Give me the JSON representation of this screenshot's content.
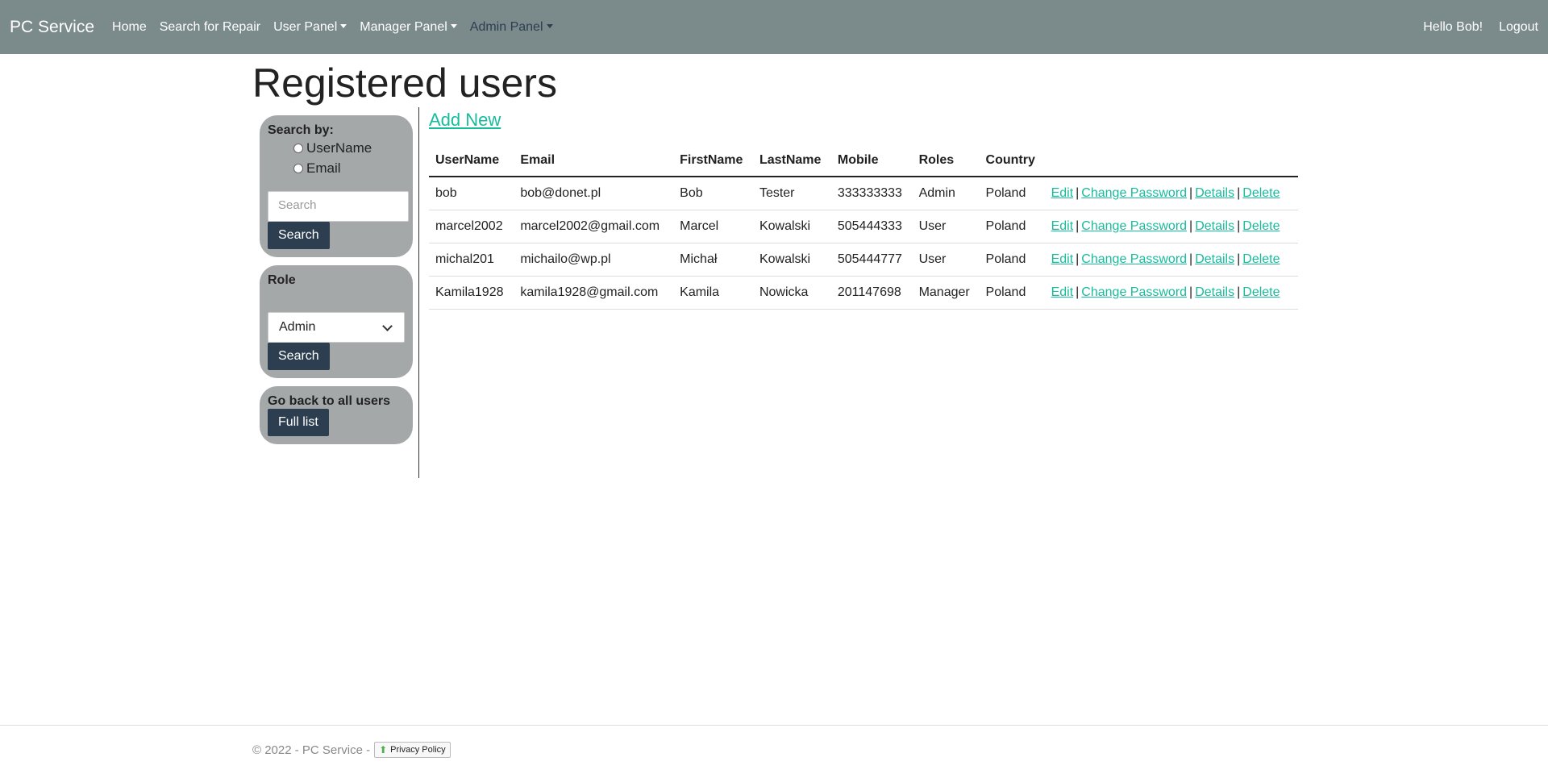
{
  "navbar": {
    "brand": "PC Service",
    "links": {
      "home": "Home",
      "search_repair": "Search for Repair",
      "user_panel": "User Panel",
      "manager_panel": "Manager Panel",
      "admin_panel": "Admin Panel"
    },
    "greeting": "Hello Bob!",
    "logout": "Logout"
  },
  "page_title": "Registered users",
  "sidebar": {
    "search_panel": {
      "title": "Search by:",
      "options": [
        "UserName",
        "Email"
      ],
      "placeholder": "Search",
      "button": "Search"
    },
    "role_panel": {
      "title": "Role",
      "selected": "Admin",
      "button": "Search"
    },
    "back_panel": {
      "title": "Go back to all users",
      "button": "Full list"
    }
  },
  "main": {
    "add_new": "Add New",
    "columns": [
      "UserName",
      "Email",
      "FirstName",
      "LastName",
      "Mobile",
      "Roles",
      "Country"
    ],
    "actions": {
      "edit": "Edit",
      "change_password": "Change Password",
      "details": "Details",
      "delete": "Delete",
      "separator": "|"
    },
    "rows": [
      [
        "bob",
        "bob@donet.pl",
        "Bob",
        "Tester",
        "333333333",
        "Admin",
        "Poland"
      ],
      [
        "marcel2002",
        "marcel2002@gmail.com",
        "Marcel",
        "Kowalski",
        "505444333",
        "User",
        "Poland"
      ],
      [
        "michal201",
        "michailo@wp.pl",
        "Michał",
        "Kowalski",
        "505444777",
        "User",
        "Poland"
      ],
      [
        "Kamila1928",
        "kamila1928@gmail.com",
        "Kamila",
        "Nowicka",
        "201147698",
        "Manager",
        "Poland"
      ]
    ]
  },
  "footer": {
    "copyright": "© 2022 - PC Service -",
    "privacy": "Privacy Policy",
    "privacy_icon": "arrow-up-icon"
  },
  "colors": {
    "navbar": "#7b8a8b",
    "accent_link": "#18bc9c",
    "button": "#2c3e50",
    "panel": "#a5a8a9"
  }
}
